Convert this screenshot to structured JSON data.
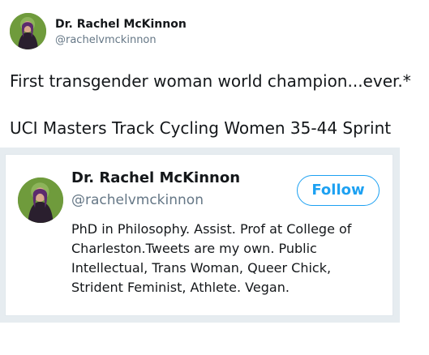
{
  "tweet": {
    "author_name": "Dr. Rachel McKinnon",
    "author_handle": "@rachelvmckinnon",
    "text_line1": "First transgender woman world champion...ever.*",
    "text_line2": "UCI Masters Track Cycling Women 35-44 Sprint"
  },
  "embedded_profile": {
    "name": "Dr. Rachel McKinnon",
    "handle": "@rachelvmckinnon",
    "follow_label": "Follow",
    "bio_lines": [
      "PhD in Philosophy. Assist. Prof at College of",
      "Charleston.Tweets are my own. Public",
      "Intellectual, Trans Woman, Queer Chick,",
      "Strident Feminist, Athlete. Vegan."
    ]
  },
  "colors": {
    "accent": "#1da1f2",
    "text": "#14171a",
    "muted": "#657786",
    "embed_background": "#e6ecf0"
  }
}
